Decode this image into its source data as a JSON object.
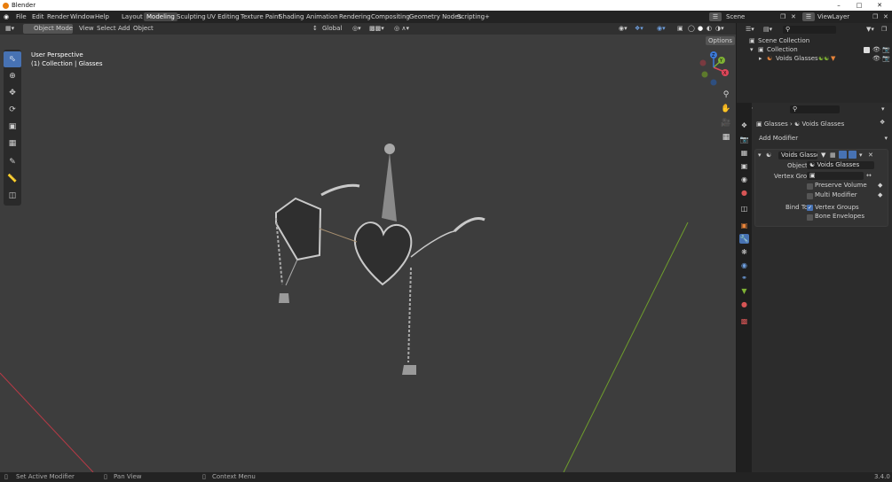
{
  "titlebar": {
    "title": "Blender"
  },
  "menu": {
    "items": [
      "File",
      "Edit",
      "Render",
      "Window",
      "Help"
    ]
  },
  "workspaces": {
    "tabs": [
      "Layout",
      "Modeling",
      "Sculpting",
      "UV Editing",
      "Texture Paint",
      "Shading",
      "Animation",
      "Rendering",
      "Compositing",
      "Geometry Nodes",
      "Scripting"
    ],
    "active": "Modeling",
    "add": "+"
  },
  "scene": {
    "name": "Scene",
    "view_layer": "ViewLayer"
  },
  "viewport": {
    "mode": "Object Mode",
    "menus": [
      "View",
      "Select",
      "Add",
      "Object"
    ],
    "orientation": "Global",
    "options_label": "Options",
    "overlay_line1": "User Perspective",
    "overlay_line2": "(1) Collection | Glasses",
    "gizmo_axes": [
      "X",
      "Y",
      "Z"
    ]
  },
  "tools": [
    "select-box-icon",
    "cursor-icon",
    "move-icon",
    "rotate-icon",
    "scale-icon",
    "transform-icon",
    "annotate-icon",
    "measure-icon",
    "add-cube-icon"
  ],
  "outliner": {
    "root": "Scene Collection",
    "collection": "Collection",
    "object": "Voids Glasses"
  },
  "properties": {
    "breadcrumb_a": "Glasses",
    "breadcrumb_b": "Voids Glasses",
    "add_modifier": "Add Modifier",
    "modifier_name": "Voids Glasses",
    "object_label": "Object",
    "object_value": "Voids Glasses",
    "vertex_group_label": "Vertex Group",
    "preserve_volume": "Preserve Volume",
    "multi_modifier": "Multi Modifier",
    "bind_to_label": "Bind To",
    "vertex_groups": "Vertex Groups",
    "bone_envelopes": "Bone Envelopes",
    "vertex_groups_checked": true,
    "bone_envelopes_checked": false
  },
  "statusbar": {
    "left": "Set Active Modifier",
    "middle": "Pan View",
    "right": "Context Menu",
    "version": "3.4.0"
  },
  "colors": {
    "accent": "#4772b3",
    "x_axis": "#e0475a",
    "y_axis": "#7fb234",
    "z_axis": "#3d7ad9",
    "modifier_orange": "#e8843a"
  }
}
